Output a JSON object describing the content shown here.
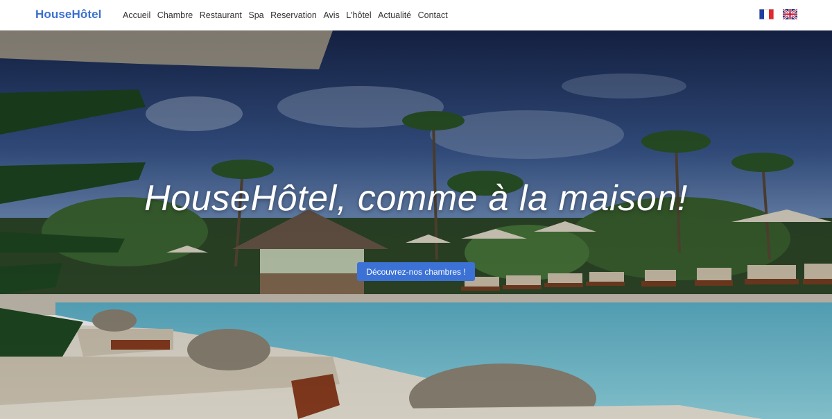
{
  "navbar": {
    "brand": "HouseHôtel",
    "links": [
      "Accueil",
      "Chambre",
      "Restaurant",
      "Spa",
      "Reservation",
      "Avis",
      "L'hôtel",
      "Actualité",
      "Contact"
    ],
    "languages": [
      {
        "name": "french-flag-icon"
      },
      {
        "name": "uk-flag-icon"
      }
    ],
    "brand_color": "#3a6fd0"
  },
  "hero": {
    "title": "HouseHôtel, comme à la maison!",
    "cta_label": "Découvrez-nos chambres !",
    "cta_color": "#3c72d6"
  }
}
